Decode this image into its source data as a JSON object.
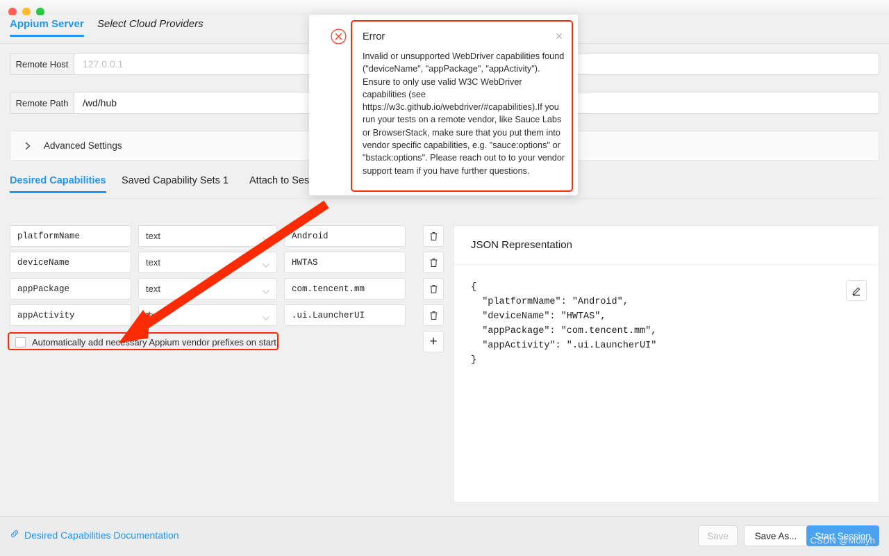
{
  "window": {
    "traffic_lights": [
      "close",
      "minimize",
      "maximize"
    ]
  },
  "server_tabs": [
    {
      "label": "Appium Server",
      "active": true
    },
    {
      "label": "Select Cloud Providers",
      "active": false
    }
  ],
  "form": {
    "remote_host": {
      "label": "Remote Host",
      "value": "",
      "placeholder": "127.0.0.1"
    },
    "remote_path": {
      "label": "Remote Path",
      "value": "/wd/hub",
      "placeholder": "/wd/hub"
    },
    "advanced_settings_label": "Advanced Settings",
    "advanced_chevron": "chevron-right-icon"
  },
  "capability_tabs": [
    {
      "label": "Desired Capabilities",
      "active": true
    },
    {
      "label": "Saved Capability Sets 1",
      "active": false
    },
    {
      "label": "Attach to Session",
      "active": false
    }
  ],
  "capabilities": {
    "rows": [
      {
        "name": "platformName",
        "type": "text",
        "value": "Android"
      },
      {
        "name": "deviceName",
        "type": "text",
        "value": "HWTAS"
      },
      {
        "name": "appPackage",
        "type": "text",
        "value": "com.tencent.mm"
      },
      {
        "name": "appActivity",
        "type": "text",
        "value": ".ui.LauncherUI"
      }
    ],
    "delete_icon": "trash-icon",
    "add_label": "+",
    "auto_prefix": {
      "label": "Automatically add necessary Appium vendor prefixes on start",
      "checked": false
    }
  },
  "json_panel": {
    "title": "JSON Representation",
    "edit_icon": "pencil-icon",
    "content": "{\n  \"platformName\": \"Android\",\n  \"deviceName\": \"HWTAS\",\n  \"appPackage\": \"com.tencent.mm\",\n  \"appActivity\": \".ui.LauncherUI\"\n}"
  },
  "error_modal": {
    "icon": "error-circle-x-icon",
    "title": "Error",
    "close_icon": "close-icon",
    "message": "Invalid or unsupported WebDriver capabilities found (\"deviceName\", \"appPackage\", \"appActivity\"). Ensure to only use valid W3C WebDriver capabilities (see https://w3c.github.io/webdriver/#capabilities).If you run your tests on a remote vendor, like Sauce Labs or BrowserStack, make sure that you put them into vendor specific capabilities, e.g. \"sauce:options\" or \"bstack:options\". Please reach out to to your vendor support team if you have further questions."
  },
  "footer": {
    "doc_link": "Desired Capabilities Documentation",
    "link_icon": "link-icon",
    "save_label": "Save",
    "save_as_label": "Save As...",
    "start_session_label": "Start Session"
  },
  "watermark": "CSDN @Moilyh",
  "colors": {
    "accent_blue": "#2196f3",
    "primary_button": "#4aa3f0",
    "annotation_red": "#fc2b04",
    "error_icon": "#fa3f2a"
  }
}
